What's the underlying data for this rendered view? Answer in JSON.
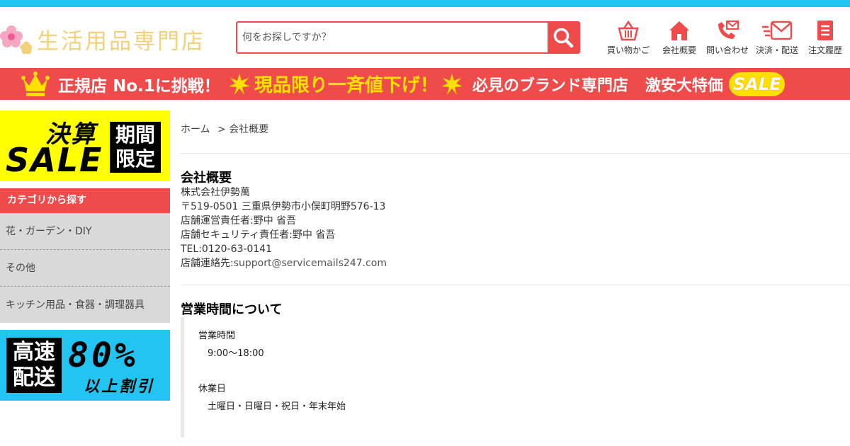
{
  "colors": {
    "accent": "#f04b4b",
    "topline": "#22c4f2",
    "banner_yellow": "#ffe100",
    "sidebar_gray": "#d9d9d9"
  },
  "header": {
    "logo_text": "生活用品専門店",
    "search_placeholder": "何をお探しですか？",
    "nav": [
      {
        "label": "買い物かご",
        "icon": "basket-icon"
      },
      {
        "label": "会社概要",
        "icon": "home-icon"
      },
      {
        "label": "問い合わせ",
        "icon": "phone-mail-icon"
      },
      {
        "label": "決済・配送",
        "icon": "delivery-mail-icon"
      },
      {
        "label": "注文履歴",
        "icon": "list-icon"
      }
    ]
  },
  "banner": {
    "part1": "正規店 No.1に挑戦！",
    "part2": "現品限り一斉値下げ！",
    "part3": "必見のブランド専門店",
    "part4": "激安大特価",
    "badge": "SALE"
  },
  "sidebar": {
    "sale_promo": {
      "kessan": "決算",
      "sale": "SALE",
      "limit_line1": "期間",
      "limit_line2": "限定"
    },
    "category_heading": "カテゴリから探す",
    "categories": [
      "花・ガーデン・DIY",
      "その他",
      "キッチン用品・食器・調理器具"
    ],
    "fast_promo": {
      "line1": "高速",
      "line2": "配送",
      "percent": "80%",
      "sub": "以上割引"
    }
  },
  "main": {
    "breadcrumb": {
      "home": "ホーム",
      "current": "> 会社概要"
    },
    "company": {
      "title": "会社概要",
      "name": "株式会社伊勢萬",
      "address": "〒519-0501 三重県伊勢市小俣町明野576-13",
      "manager": "店舗運営責任者:野中 省吾",
      "security": "店舗セキュリティ責任者:野中 省吾",
      "tel": "TEL:0120-63-0141",
      "contact_label": "店舗連絡先:",
      "contact_email": "support@servicemails247.com"
    },
    "hours": {
      "title": "営業時間について",
      "hours_label": "営業時間",
      "hours_value": "9:00～18:00",
      "closed_label": "休業日",
      "closed_value": "土曜日・日曜日・祝日・年末年始"
    }
  }
}
